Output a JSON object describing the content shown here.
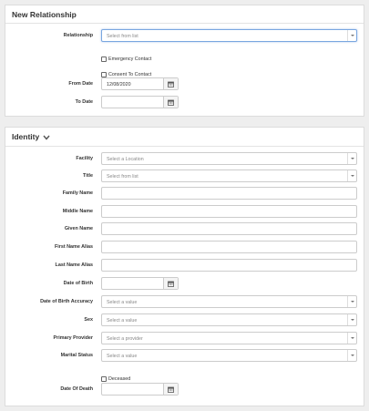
{
  "relationship_panel": {
    "title": "New Relationship",
    "relationship_label": "Relationship",
    "relationship_placeholder": "Select from list",
    "emergency_contact_label": "Emergency Contact",
    "consent_to_contact_label": "Consent To Contact",
    "from_date_label": "From Date",
    "from_date_value": "12/08/2020",
    "to_date_label": "To Date",
    "to_date_value": ""
  },
  "identity_panel": {
    "title": "Identity",
    "facility_label": "Facility",
    "facility_placeholder": "Select a Location",
    "title_label": "Title",
    "title_placeholder": "Select from list",
    "family_name_label": "Family Name",
    "middle_name_label": "Middle Name",
    "given_name_label": "Given Name",
    "first_name_alias_label": "First Name Alias",
    "last_name_alias_label": "Last Name Alias",
    "dob_label": "Date of Birth",
    "dob_accuracy_label": "Date of Birth Accuracy",
    "dob_accuracy_placeholder": "Select a value",
    "sex_label": "Sex",
    "sex_placeholder": "Select a value",
    "primary_provider_label": "Primary Provider",
    "primary_provider_placeholder": "Select a provider",
    "marital_status_label": "Marital Status",
    "marital_status_placeholder": "Select a value",
    "deceased_label": "Deceased",
    "date_of_death_label": "Date Of Death"
  },
  "icons": {
    "calendar": "calendar-icon",
    "chevron": "chevron-down-icon"
  }
}
